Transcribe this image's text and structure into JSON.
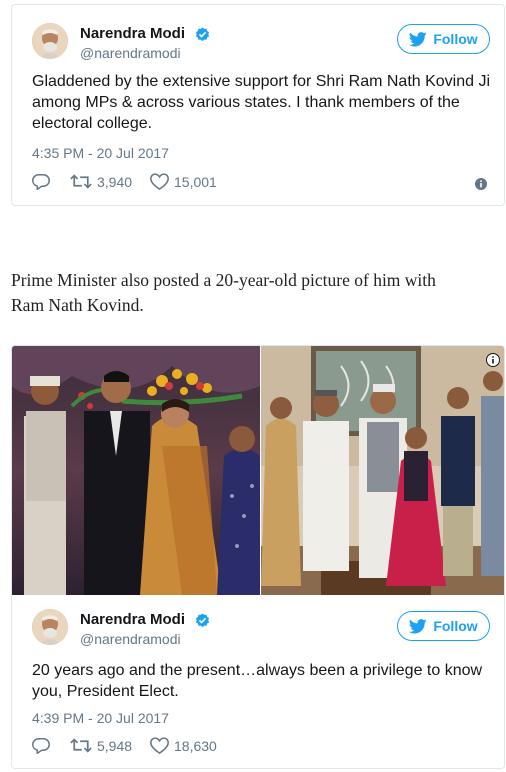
{
  "tweet1": {
    "author_name": "Narendra Modi",
    "handle": "@narendramodi",
    "follow_label": "Follow",
    "text_lines": [
      "Gladdened by the extensive support for Shri Ram Nath Kovind Ji",
      "among MPs & across various states. I thank members of the",
      "electoral college."
    ],
    "timestamp": "4:35 PM - 20 Jul 2017",
    "retweets": "3,940",
    "likes": "15,001"
  },
  "article": {
    "lines": [
      "Prime Minister also posted a 20-year-old picture of him with",
      "Ram Nath Kovind."
    ]
  },
  "tweet2": {
    "author_name": "Narendra Modi",
    "handle": "@narendramodi",
    "follow_label": "Follow",
    "text_lines": [
      "20 years ago and the present…always been a privilege to know",
      "you, President Elect."
    ],
    "timestamp": "4:39 PM - 20 Jul 2017",
    "retweets": "5,948",
    "likes": "18,630"
  },
  "colors": {
    "accent": "#1da1f2",
    "muted": "#657786",
    "border": "#e1e8ed"
  },
  "icons": [
    "verified-badge-icon",
    "twitter-bird-icon",
    "reply-icon",
    "retweet-icon",
    "heart-icon",
    "info-icon"
  ]
}
